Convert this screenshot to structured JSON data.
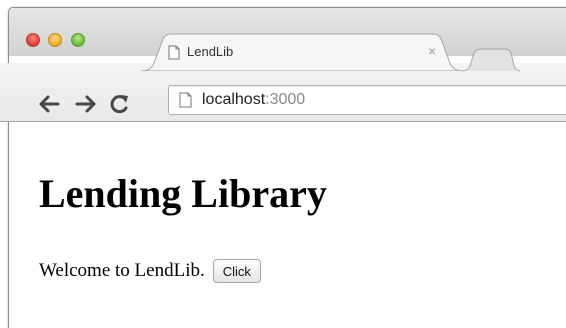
{
  "browser": {
    "tab": {
      "title": "LendLib",
      "close_glyph": "×"
    },
    "address_bar": {
      "host": "localhost",
      "port": ":3000"
    },
    "icons": [
      "back-arrow-icon",
      "forward-arrow-icon",
      "reload-icon",
      "page-icon",
      "close-icon"
    ],
    "colors": {
      "traffic_close": "#e0443e",
      "traffic_minimize": "#f1b12f",
      "traffic_zoom": "#6fbf3d"
    }
  },
  "page": {
    "heading": "Lending Library",
    "welcome_text": "Welcome to LendLib.",
    "button_label": "Click"
  }
}
